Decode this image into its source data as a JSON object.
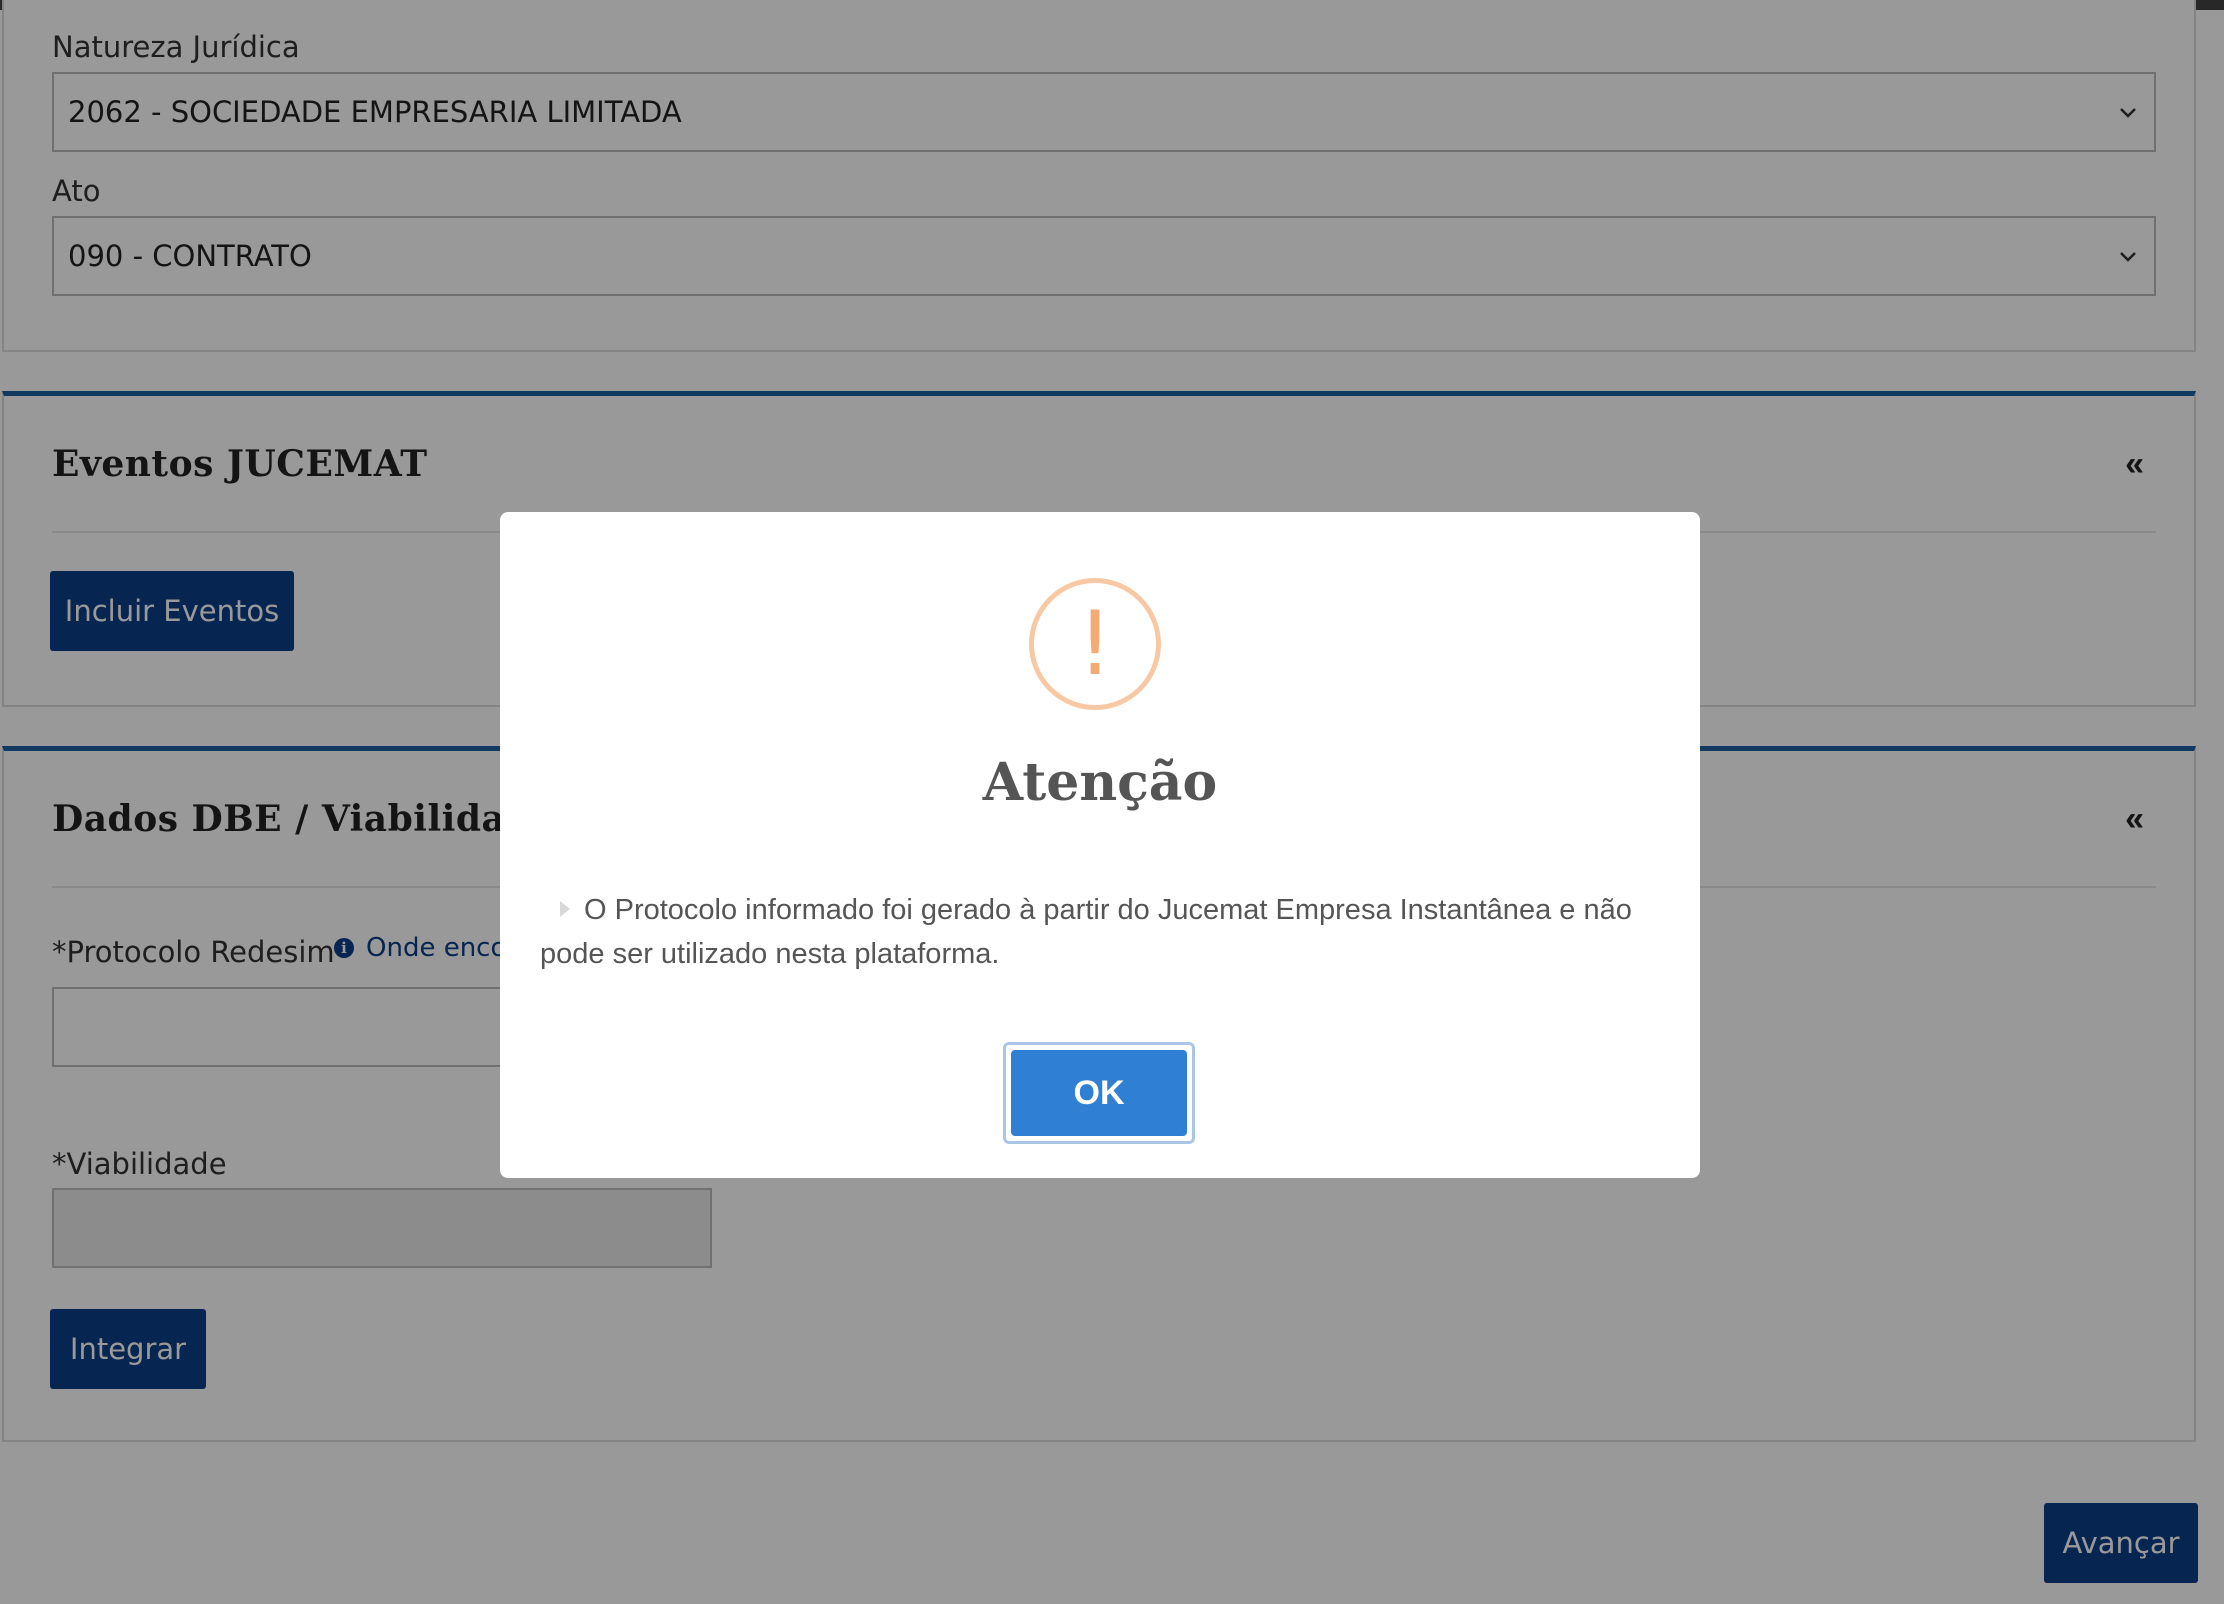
{
  "form": {
    "natureza_label": "Natureza Jurídica",
    "natureza_value": "2062 - SOCIEDADE EMPRESARIA LIMITADA",
    "ato_label": "Ato",
    "ato_value": "090 - CONTRATO"
  },
  "eventos": {
    "title": "Eventos JUCEMAT",
    "collapse": "«",
    "include_button": "Incluir Eventos"
  },
  "dbe": {
    "title": "Dados DBE / Viabilidade",
    "collapse": "«",
    "protocolo_label": "*Protocolo Redesim",
    "help_link": "Onde encont",
    "viabilidade_label": "*Viabilidade",
    "integrar_button": "Integrar"
  },
  "footer": {
    "avancar_button": "Avançar"
  },
  "modal": {
    "icon_glyph": "!",
    "title": "Atenção",
    "message": "O Protocolo informado foi gerado à partir do Jucemat Empresa Instantânea e não pode ser utilizado nesta plataforma.",
    "ok_button": "OK"
  },
  "colors": {
    "primary": "#0b3f86",
    "section_accent": "#1f5f9f",
    "ok_button": "#2f7fd4",
    "warning_icon": "#f5aa74"
  }
}
